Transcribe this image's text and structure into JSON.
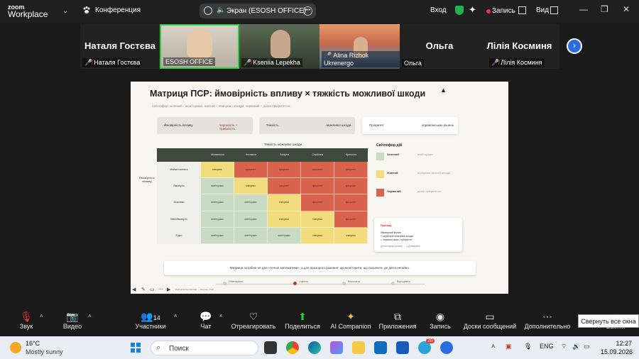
{
  "titlebar": {
    "logo_line1": "zoom",
    "logo_line2": "Workplace",
    "conference": "Конференция",
    "screen_share": "Экран (ESOSH OFFICE)",
    "login": "Вход",
    "record": "Запись",
    "view": "Вид"
  },
  "participants": [
    {
      "big_name": "Наталя Гостєва",
      "label": "Наталя Гостєва",
      "muted": true
    },
    {
      "big_name": "",
      "label": "ESOSH OFFICE",
      "muted": false
    },
    {
      "big_name": "",
      "label": "Kseniia Lepekha",
      "muted": true
    },
    {
      "big_name": "",
      "label": "Alina Rizhok Ukrenergo",
      "muted": true
    },
    {
      "big_name": "Ольга",
      "label": "Ольга",
      "muted": false
    },
    {
      "big_name": "Лілія Косминя",
      "label": "Лілія Косминя",
      "muted": true
    }
  ],
  "slide": {
    "title": "Матриця ПСР: ймовірність впливу × тяжкість можливої шкоди",
    "subtitle": "Світлофор: зелений – моніторимо, жовтий – плануємо заходи, червоний – діємо пріоритетно.",
    "card1_left": "Ймовірність впливу",
    "card1_right": "черговість + тривалість",
    "card2_left": "Тяжкість",
    "card2_right": "можливої шкоди",
    "card3_left": "Пріоритет",
    "card3_right": "управлінських рішень",
    "matrix_caption": "Тяжкість можливої шкоди",
    "y_axis": "Ймовірність впливу",
    "col_headers": [
      "Мінімальна",
      "Незначна",
      "Помірна",
      "Серйозна",
      "Критична"
    ],
    "row_labels": [
      "Майже напевно",
      "Ймовірно",
      "Можливо",
      "Малоймовірно",
      "Рідко"
    ],
    "cell_labels": {
      "green": "моніторимо",
      "yellow": "плануємо",
      "red": "пріоритет"
    },
    "legend_title": "Світлофор дій",
    "legend": [
      {
        "name": "Зелений",
        "desc": "моніторимо",
        "color": "#c9dcc3"
      },
      {
        "name": "Жовтий",
        "desc": "плануємо захисні заходи",
        "color": "#f2dc7b"
      },
      {
        "name": "Червоний",
        "desc": "діємо пріоритетно",
        "color": "#d9634c"
      }
    ],
    "example_title": "Приклад",
    "example_lines": [
      "Ймовірний вплив",
      "+ серйозна можлива шкода",
      "= червона зона / пріоритет"
    ],
    "example_note": "Деталізація шкоди → у Довіднику",
    "footer": "Матриця потрібна не для «точної математики», а для прозорого рішення: що моніторити, що посилити, де діяти негайно.",
    "steps": [
      "Обмежувати",
      "Оцінити",
      "Визначати",
      "Вирішувати"
    ],
    "slide_footer_text": "2025-ESOSH OFFICE — Матриця ПСР"
  },
  "toolbar": {
    "audio": "Звук",
    "video": "Видео",
    "participants_count": "14",
    "participants": "Участники",
    "chat": "Чат",
    "react": "Отреагировать",
    "share": "Поделиться",
    "ai": "AI Companion",
    "apps": "Приложения",
    "record": "Запись",
    "whiteboards": "Доски сообщений",
    "more": "Дополнительно",
    "leave": "Выйти",
    "tooltip": "Свернуть все окна"
  },
  "taskbar": {
    "temp": "16°C",
    "weather": "Mostly sunny",
    "search_placeholder": "Поиск",
    "lang": "ENG",
    "time": "12:27",
    "date": "15.09.2026",
    "badge": "20"
  },
  "colors": {
    "green": "#c9dcc3",
    "yellow": "#f2dc7b",
    "red": "#d9634c",
    "header": "#3d4a3c",
    "zoom_blue": "#2d6cdf"
  }
}
